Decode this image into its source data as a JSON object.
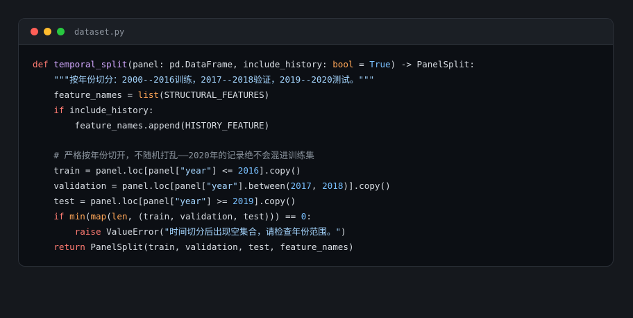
{
  "window": {
    "filename": "dataset.py"
  },
  "code": {
    "l1": {
      "def": "def",
      "fname": "temporal_split",
      "params_a": "(panel: pd.DataFrame, include_history: ",
      "bool": "bool",
      "eq": " = ",
      "true": "True",
      "ret": ") -> PanelSplit:"
    },
    "l2": {
      "indent": "    ",
      "docstring": "\"\"\"按年份切分：2000--2016训练，2017--2018验证，2019--2020测试。\"\"\""
    },
    "l3": {
      "indent": "    ",
      "a": "feature_names = ",
      "list": "list",
      "b": "(STRUCTURAL_FEATURES)"
    },
    "l4": {
      "indent": "    ",
      "if": "if",
      "b": " include_history:"
    },
    "l5": {
      "indent": "        ",
      "a": "feature_names.append(HISTORY_FEATURE)"
    },
    "l7": {
      "indent": "    ",
      "comment": "# 严格按年份切开，不随机打乱——2020年的记录绝不会混进训练集"
    },
    "l8": {
      "indent": "    ",
      "a": "train = panel.loc[panel[",
      "s": "\"year\"",
      "b": "] <= ",
      "n": "2016",
      "c": "].copy()"
    },
    "l9": {
      "indent": "    ",
      "a": "validation = panel.loc[panel[",
      "s": "\"year\"",
      "b": "].between(",
      "n1": "2017",
      "comma": ", ",
      "n2": "2018",
      "c": ")].copy()"
    },
    "l10": {
      "indent": "    ",
      "a": "test = panel.loc[panel[",
      "s": "\"year\"",
      "b": "] >= ",
      "n": "2019",
      "c": "].copy()"
    },
    "l11": {
      "indent": "    ",
      "if": "if",
      "sp": " ",
      "min": "min",
      "p1": "(",
      "map": "map",
      "p2": "(",
      "len": "len",
      "b": ", (train, validation, test))) == ",
      "n": "0",
      "colon": ":"
    },
    "l12": {
      "indent": "        ",
      "raise": "raise",
      "a": " ValueError(",
      "s": "\"时间切分后出现空集合，请检查年份范围。\"",
      "b": ")"
    },
    "l13": {
      "indent": "    ",
      "return": "return",
      "a": " PanelSplit(train, validation, test, feature_names)"
    }
  }
}
